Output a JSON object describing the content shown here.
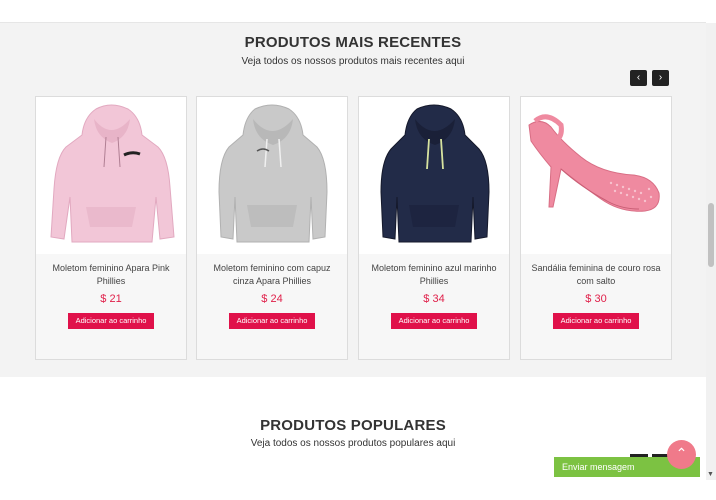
{
  "recent": {
    "title": "PRODUTOS MAIS RECENTES",
    "subtitle": "Veja todos os nossos produtos mais recentes aqui",
    "prev_icon": "chevron-left-icon",
    "next_icon": "chevron-right-icon",
    "prev_glyph": "‹",
    "next_glyph": "›",
    "products": [
      {
        "name": "Moletom feminino Apara Pink Phillies",
        "price": "$ 21",
        "button": "Adicionar ao carrinho",
        "image": "pink-hoodie"
      },
      {
        "name": "Moletom feminino com capuz cinza Apara Phillies",
        "price": "$ 24",
        "button": "Adicionar ao carrinho",
        "image": "gray-hoodie"
      },
      {
        "name": "Moletom feminino azul marinho Phillies",
        "price": "$ 34",
        "button": "Adicionar ao carrinho",
        "image": "navy-hoodie"
      },
      {
        "name": "Sandália feminina de couro rosa com salto",
        "price": "$ 30",
        "button": "Adicionar ao carrinho",
        "image": "pink-heel-sandal"
      }
    ]
  },
  "popular": {
    "title": "PRODUTOS POPULARES",
    "subtitle": "Veja todos os nossos produtos populares aqui"
  },
  "chat": {
    "label": "Enviar mensagem"
  },
  "fab": {
    "icon": "chevron-up-icon",
    "glyph": "⌃"
  },
  "colors": {
    "accent": "#e0114a",
    "price": "#e0204a",
    "chat": "#7cc242",
    "section_bg": "#f3f3f3"
  }
}
